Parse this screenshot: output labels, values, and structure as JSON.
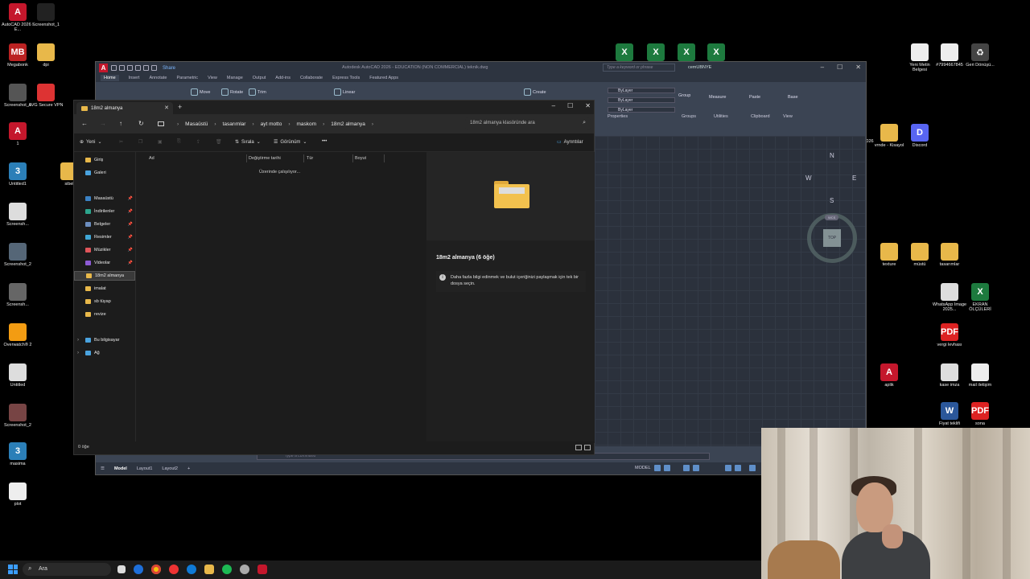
{
  "desktop": {
    "left_icons": [
      {
        "label": "AutoCAD 2026 - E...",
        "glyph": "A",
        "color": "#c4172c"
      },
      {
        "label": "Screenshot_1",
        "glyph": "",
        "color": "#222"
      },
      {
        "label": "Megabonk",
        "glyph": "MB",
        "color": "#b22"
      },
      {
        "label": "dpi",
        "glyph": "",
        "color": "#e8b84a"
      },
      {
        "label": "Screenshot_1",
        "glyph": "",
        "color": "#555"
      },
      {
        "label": "AVG Secure VPN",
        "glyph": "",
        "color": "#d33"
      },
      {
        "label": "1",
        "glyph": "A",
        "color": "#c4172c"
      },
      {
        "label": "Untitled1",
        "glyph": "3",
        "color": "#2b7fb8"
      },
      {
        "label": "sibel",
        "glyph": "",
        "color": "#e8b84a"
      },
      {
        "label": "Screensh...",
        "glyph": "",
        "color": "#ddd"
      },
      {
        "label": "Screenshot_2",
        "glyph": "",
        "color": "#567"
      },
      {
        "label": "Screensh...",
        "glyph": "",
        "color": "#666"
      },
      {
        "label": "Overwatch® 2",
        "glyph": "",
        "color": "#f39c12"
      },
      {
        "label": "Untitled",
        "glyph": "",
        "color": "#ddd"
      },
      {
        "label": "Screenshot_2",
        "glyph": "",
        "color": "#744"
      },
      {
        "label": "masima",
        "glyph": "3",
        "color": "#2b7fb8"
      },
      {
        "label": "plot",
        "glyph": "",
        "color": "#eee"
      }
    ],
    "right_icons": [
      {
        "label": "Yeni Metin Belgesi",
        "glyph": "",
        "color": "#eee"
      },
      {
        "label": "#7994667845",
        "glyph": "",
        "color": "#eee"
      },
      {
        "label": "Geri Dönüşü...",
        "glyph": "♻",
        "color": "#444"
      },
      {
        "label": "vrnde - Kisayol",
        "glyph": "",
        "color": "#e8b84a"
      },
      {
        "label": "Discord",
        "glyph": "D",
        "color": "#5865f2"
      },
      {
        "label": "texture",
        "glyph": "",
        "color": "#e8b84a"
      },
      {
        "label": "müstü",
        "glyph": "",
        "color": "#e8b84a"
      },
      {
        "label": "tasarımlar",
        "glyph": "",
        "color": "#e8b84a"
      },
      {
        "label": "WhatsApp Image 2025...",
        "glyph": "",
        "color": "#ddd"
      },
      {
        "label": "EKRAN ÖLÇÜLERİ",
        "glyph": "X",
        "color": "#1d7a3e"
      },
      {
        "label": "vergi levhası",
        "glyph": "PDF",
        "color": "#d22"
      },
      {
        "label": "aplik",
        "glyph": "A",
        "color": "#c4172c"
      },
      {
        "label": "kase imza",
        "glyph": "",
        "color": "#ddd"
      },
      {
        "label": "mail iletişim",
        "glyph": "",
        "color": "#eee"
      },
      {
        "label": "Fiyat teklifi",
        "glyph": "W",
        "color": "#2b579a"
      },
      {
        "label": "sona",
        "glyph": "PDF",
        "color": "#d22"
      }
    ],
    "excel_glyph": "X",
    "partial_label": "026"
  },
  "acad": {
    "logo": "A",
    "share": "Share",
    "title": "Autodesk AutoCAD 2026 - EDUCATION (NON COMMERCIAL)    teknik.dwg",
    "search_placeholder": "Type a keyword or phrase",
    "user": "cemUBNYE",
    "tabs": [
      "Home",
      "Insert",
      "Annotate",
      "Parametric",
      "View",
      "Manage",
      "Output",
      "Add-ins",
      "Collaborate",
      "Express Tools",
      "Featured Apps"
    ],
    "ribbon": {
      "move": "Move",
      "rotate": "Rotate",
      "trim": "Trim",
      "linear": "Linear",
      "create": "Create",
      "bylayer": "ByLayer",
      "group": "Group",
      "measure": "Measure",
      "paste": "Paste",
      "base": "Base",
      "properties": "Properties",
      "groups": "Groups",
      "utilities": "Utilities",
      "clipboard": "Clipboard",
      "view": "View"
    },
    "viewcube": {
      "n": "N",
      "s": "S",
      "e": "E",
      "w": "W",
      "top": "TOP",
      "wcs": "WCS"
    },
    "command_placeholder": "Type a command",
    "layout_tabs": [
      "Model",
      "Layout1",
      "Layout2"
    ],
    "status_model": "MODEL"
  },
  "explorer": {
    "tab_title": "18m2 almanya",
    "breadcrumbs": [
      "Masaüstü",
      "tasarımlar",
      "ayt motto",
      "maskom",
      "18m2 almanya"
    ],
    "search_placeholder": "18m2 almanya klasöründe ara",
    "cmd": {
      "new": "Yeni",
      "sort": "Sırala",
      "view": "Görünüm",
      "details": "Ayrıntılar"
    },
    "nav_items": [
      {
        "label": "Giriş",
        "color": "#e8b84a",
        "pin": false
      },
      {
        "label": "Galeri",
        "color": "#4aa3df",
        "pin": false
      },
      {
        "label": "Masaüstü",
        "color": "#3b82c4",
        "pin": true
      },
      {
        "label": "İndirilenler",
        "color": "#2ca58d",
        "pin": true
      },
      {
        "label": "Belgeler",
        "color": "#6c8ebf",
        "pin": true
      },
      {
        "label": "Resimler",
        "color": "#3fa7d6",
        "pin": true
      },
      {
        "label": "Müzikler",
        "color": "#e0555a",
        "pin": true
      },
      {
        "label": "Videolar",
        "color": "#8e5bd6",
        "pin": true
      },
      {
        "label": "18m2 almanya",
        "color": "#e8b84a",
        "pin": false
      },
      {
        "label": "imalat",
        "color": "#e8b84a",
        "pin": false
      },
      {
        "label": "sb tüyap",
        "color": "#e8b84a",
        "pin": false
      },
      {
        "label": "revize",
        "color": "#e8b84a",
        "pin": false
      },
      {
        "label": "Bu bilgisayar",
        "color": "#4aa3df",
        "pin": false
      },
      {
        "label": "Ağ",
        "color": "#4aa3df",
        "pin": false
      }
    ],
    "columns": {
      "name": "Ad",
      "modified": "Değiştirme tarihi",
      "type": "Tür",
      "size": "Boyut"
    },
    "working": "Üzerinde çalışılıyor...",
    "preview_title": "18m2 almanya (6 öğe)",
    "preview_info": "Daha fazla bilgi edinmek ve bulut içeriğinizi paylaşmak için tek bir dosya seçin.",
    "status": "0 öğe"
  },
  "taskbar": {
    "search": "Ara"
  }
}
